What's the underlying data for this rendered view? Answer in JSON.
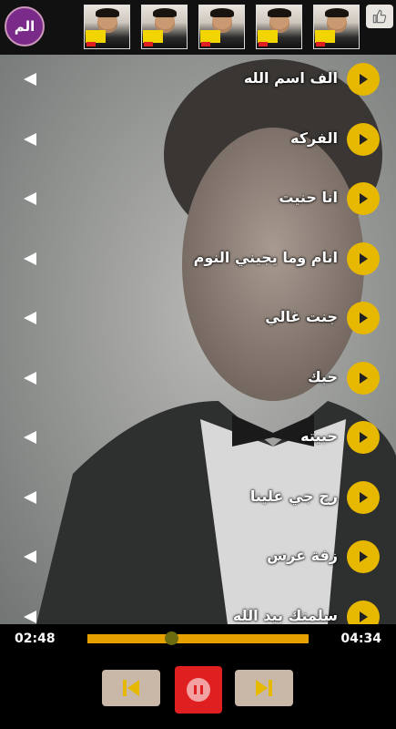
{
  "header": {
    "app_icon_text": "الم",
    "like_icon": "thumbs-up-icon",
    "thumbnails": [
      "ad-thumbnail",
      "ad-thumbnail",
      "ad-thumbnail",
      "ad-thumbnail",
      "ad-thumbnail"
    ]
  },
  "songs": [
    {
      "title": "الف اسم الله"
    },
    {
      "title": "الفركه"
    },
    {
      "title": "انا حنيت"
    },
    {
      "title": "انام وما يجيني النوم"
    },
    {
      "title": "جنت غالي"
    },
    {
      "title": "حبك"
    },
    {
      "title": "حبيته"
    },
    {
      "title": "رح جي علينا"
    },
    {
      "title": "زفة عرس"
    },
    {
      "title": "سلمتك بيد الله"
    }
  ],
  "player": {
    "elapsed": "02:48",
    "total": "04:34",
    "progress": 0.38
  },
  "colors": {
    "accent": "#e6b800",
    "pause": "#e02020",
    "control_bg": "#c9b7a8"
  }
}
